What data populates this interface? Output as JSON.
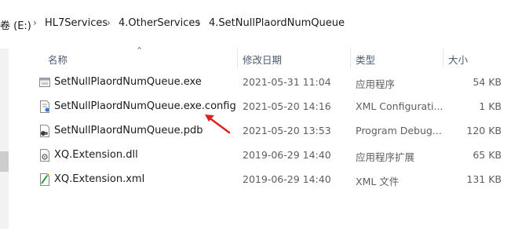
{
  "breadcrumb": {
    "drive": "卷 (E:)",
    "items": [
      "HL7Services",
      "4.OtherServices",
      "4.SetNullPlaordNumQueue"
    ]
  },
  "columns": {
    "name": "名称",
    "date": "修改日期",
    "type": "类型",
    "size": "大小"
  },
  "files": [
    {
      "name": "SetNullPlaordNumQueue.exe",
      "date": "2021-05-31 11:04",
      "type": "应用程序",
      "size": "54 KB",
      "icon": "exe-icon"
    },
    {
      "name": "SetNullPlaordNumQueue.exe.config",
      "date": "2021-05-20 14:16",
      "type": "XML Configurati...",
      "size": "1 KB",
      "icon": "config-icon"
    },
    {
      "name": "SetNullPlaordNumQueue.pdb",
      "date": "2021-05-20 13:53",
      "type": "Program Debug...",
      "size": "120 KB",
      "icon": "pdb-icon"
    },
    {
      "name": "XQ.Extension.dll",
      "date": "2019-06-29 14:40",
      "type": "应用程序扩展",
      "size": "65 KB",
      "icon": "dll-icon"
    },
    {
      "name": "XQ.Extension.xml",
      "date": "2019-06-29 14:40",
      "type": "XML 文件",
      "size": "131 KB",
      "icon": "xml-icon"
    }
  ],
  "colors": {
    "annotation_arrow": "#e02020",
    "header_text": "#4b5a73"
  }
}
